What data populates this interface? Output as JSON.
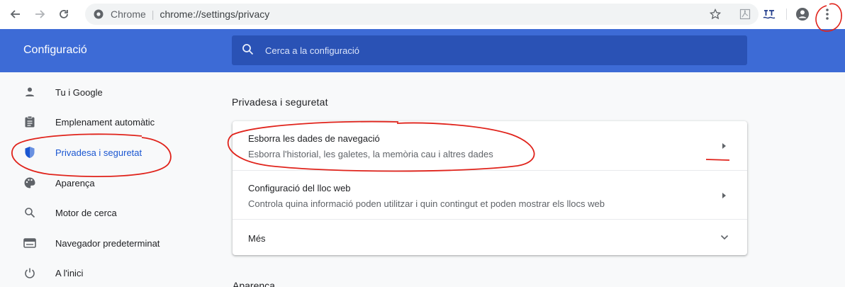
{
  "browser": {
    "omnibox_site": "Chrome",
    "omnibox_url": "chrome://settings/privacy"
  },
  "header": {
    "title": "Configuració",
    "search_placeholder": "Cerca a la configuració"
  },
  "sidebar": {
    "items": [
      {
        "label": "Tu i Google",
        "icon": "person-icon"
      },
      {
        "label": "Emplenament automàtic",
        "icon": "clipboard-icon"
      },
      {
        "label": "Privadesa i seguretat",
        "icon": "shield-icon",
        "active": true
      },
      {
        "label": "Aparença",
        "icon": "palette-icon"
      },
      {
        "label": "Motor de cerca",
        "icon": "search-icon"
      },
      {
        "label": "Navegador predeterminat",
        "icon": "browser-icon"
      },
      {
        "label": "A l'inici",
        "icon": "power-icon"
      }
    ]
  },
  "main": {
    "section_title": "Privadesa i seguretat",
    "rows": [
      {
        "title": "Esborra les dades de navegació",
        "subtitle": "Esborra l'historial, les galetes, la memòria cau i altres dades"
      },
      {
        "title": "Configuració del lloc web",
        "subtitle": "Controla quina informació poden utilitzar i quin contingut et poden mostrar els llocs web"
      },
      {
        "title": "Més"
      }
    ],
    "next_section_title": "Aparença"
  },
  "colors": {
    "header_bg": "#3d6bd6",
    "accent": "#1a56d1",
    "annotation": "#e0231b"
  }
}
